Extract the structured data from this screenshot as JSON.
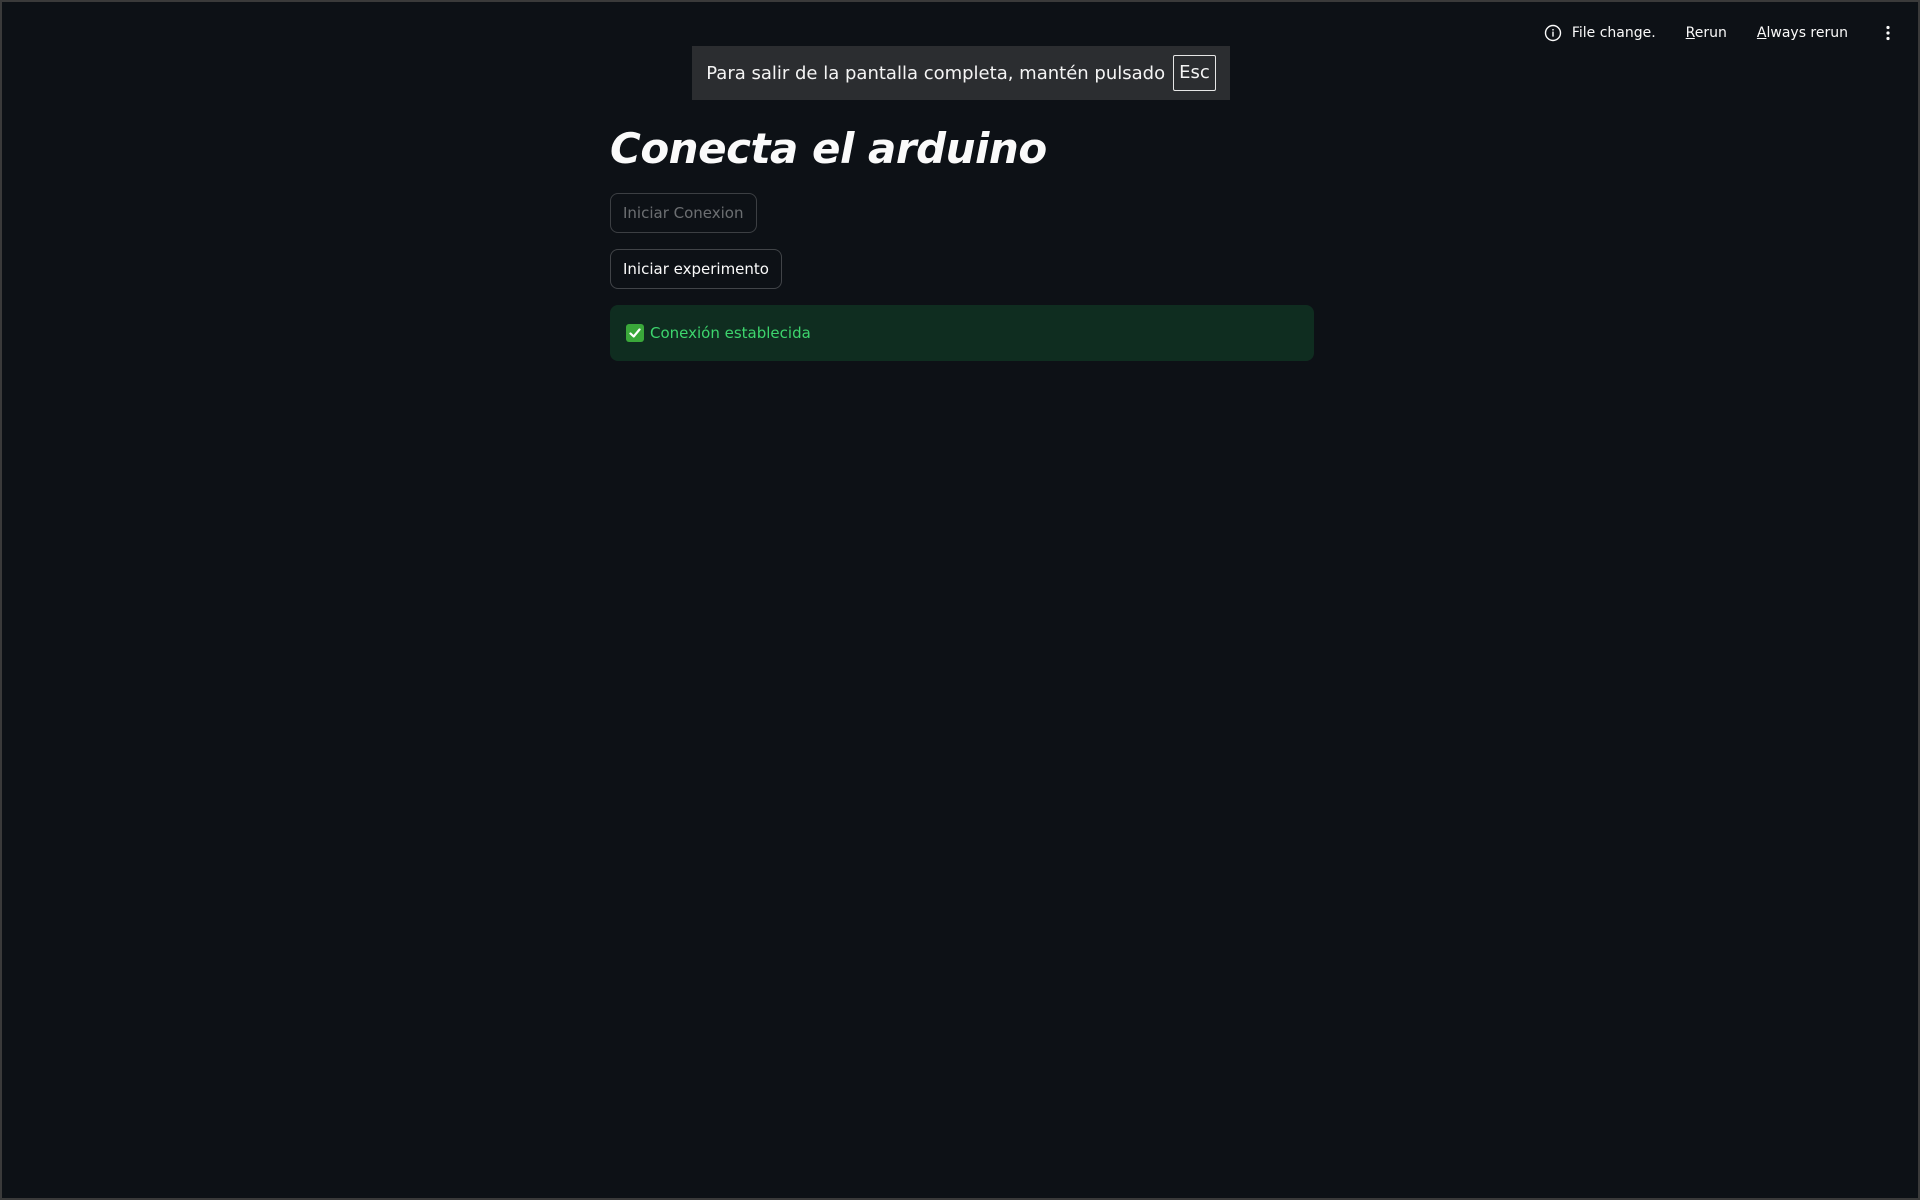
{
  "topbar": {
    "status_text": "File change.",
    "rerun_label": "Rerun",
    "always_rerun_label": "Always rerun",
    "info_icon": "info-circle-icon",
    "menu_icon": "kebab-menu-icon"
  },
  "fullscreen_notice": {
    "text": "Para salir de la pantalla completa, mantén pulsado",
    "key": "Esc"
  },
  "main": {
    "title": "Conecta el arduino",
    "buttons": [
      {
        "label": "Iniciar Conexion",
        "disabled": true
      },
      {
        "label": "Iniciar experimento",
        "disabled": false
      }
    ],
    "alert": {
      "icon": "check-mark-icon",
      "text": "Conexión establecida",
      "color": "#3dd56d"
    }
  },
  "colors": {
    "background": "#0d1116",
    "alert_bg": "#1a3a27",
    "text": "#fafafa"
  }
}
